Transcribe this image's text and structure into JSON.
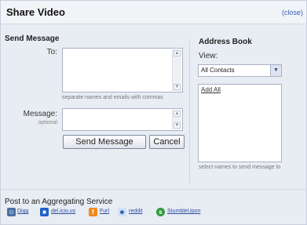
{
  "dialog": {
    "title": "Share Video",
    "close_label": "(close)"
  },
  "send_message": {
    "heading": "Send Message",
    "to_label": "To:",
    "to_hint": "separate names and emails with commas",
    "message_label": "Message:",
    "message_sublabel": "optional",
    "send_button": "Send Message",
    "cancel_button": "Cancel"
  },
  "address_book": {
    "heading": "Address Book",
    "view_label": "View:",
    "view_selected": "All Contacts",
    "add_all": "Add All",
    "hint": "select names to send message to"
  },
  "aggregating": {
    "heading": "Post to an Aggregating Service",
    "services": [
      {
        "label": "Digg",
        "icon": "digg-icon",
        "color": "#4a6fa5"
      },
      {
        "label": "del.icio.us",
        "icon": "delicious-icon",
        "color": "#1f5fc7"
      },
      {
        "label": "Furl",
        "icon": "furl-icon",
        "color": "#f08a1c"
      },
      {
        "label": "reddit",
        "icon": "reddit-icon",
        "color": "#cfe1f5"
      },
      {
        "label": "StumbleUpon",
        "icon": "stumbleupon-icon",
        "color": "#2e9a3c"
      }
    ]
  }
}
